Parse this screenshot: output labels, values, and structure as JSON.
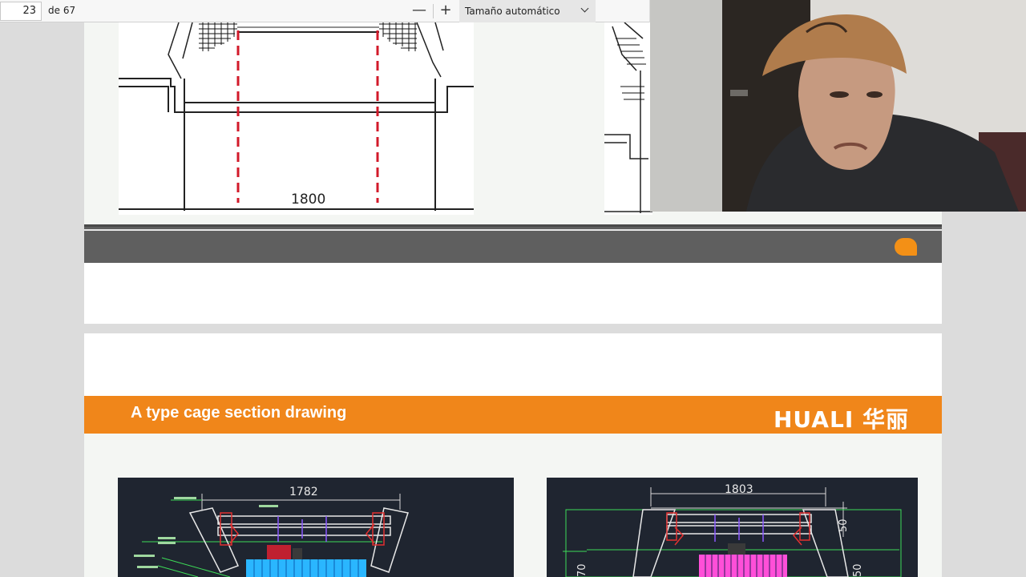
{
  "toolbar": {
    "page_current": "23",
    "page_total_label": "de 67",
    "zoom_out_label": "—",
    "zoom_in_label": "+",
    "zoom_value": "Tamaño automático"
  },
  "page1": {
    "drawing_dimension": "1800"
  },
  "page2": {
    "section_title": "A type cage section drawing",
    "brand_name": "HUALI 华丽",
    "left_drawing_dimension": "1782",
    "right_drawing_dimension": "1803",
    "right_side_dimension_top": "50",
    "right_side_dimension_low": "50",
    "left_side_dimension": "70"
  },
  "colors": {
    "accent_orange": "#f0861a",
    "band_gray": "#5f5f5f",
    "cad_background": "#1f2530"
  }
}
